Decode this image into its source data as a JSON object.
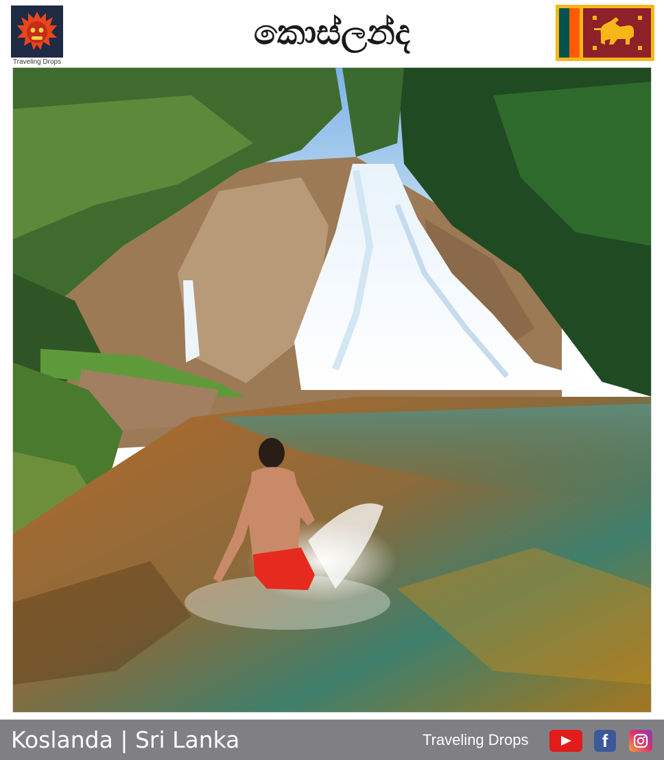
{
  "header": {
    "title": "කොස්ලන්ද",
    "logo_caption": "Traveling Drops",
    "logo_icon": "demon-mask-icon",
    "flag_icon": "sri-lanka-flag-icon"
  },
  "photo": {
    "icon": "waterfall-photo"
  },
  "footer": {
    "caption": "Koslanda | Sri Lanka",
    "brand": "Traveling Drops",
    "social": [
      "youtube-icon",
      "facebook-icon",
      "instagram-icon"
    ]
  },
  "colors": {
    "footer_bg": "#808084",
    "flag_border": "#f7b718",
    "flag_maroon": "#8d2029",
    "flag_green": "#00534e",
    "flag_orange": "#ff5b00"
  }
}
